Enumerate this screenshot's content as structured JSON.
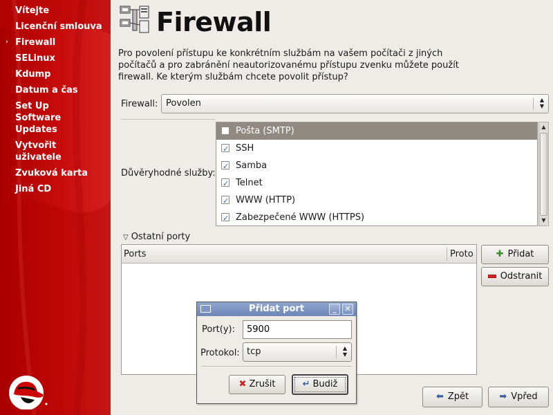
{
  "sidebar": {
    "items": [
      {
        "label": "Vítejte",
        "current": false
      },
      {
        "label": "Licenční smlouva",
        "current": false
      },
      {
        "label": "Firewall",
        "current": true
      },
      {
        "label": "SELinux",
        "current": false
      },
      {
        "label": "Kdump",
        "current": false
      },
      {
        "label": "Datum a čas",
        "current": false
      },
      {
        "label": "Set Up Software Updates",
        "current": false
      },
      {
        "label": "Vytvořit uživatele",
        "current": false
      },
      {
        "label": "Zvuková karta",
        "current": false
      },
      {
        "label": "Jiná CD",
        "current": false
      }
    ],
    "current_marker": "›"
  },
  "header": {
    "title": "Firewall",
    "icon": "firewall-icon"
  },
  "description": "Pro povolení přístupu ke konkrétním službám na vašem počítači z jiných počítačů a pro zabránění neautorizovanému přístupu zvenku můžete použít firewall. Ke kterým službám chcete povolit přístup?",
  "firewall": {
    "label": "Firewall:",
    "value": "Povolen"
  },
  "trusted": {
    "label": "Důvěryhodné služby:",
    "services": [
      {
        "name": "Pošta (SMTP)",
        "checked": false,
        "selected": true
      },
      {
        "name": "SSH",
        "checked": true,
        "selected": false
      },
      {
        "name": "Samba",
        "checked": true,
        "selected": false
      },
      {
        "name": "Telnet",
        "checked": true,
        "selected": false
      },
      {
        "name": "WWW (HTTP)",
        "checked": true,
        "selected": false
      },
      {
        "name": "Zabezpečené WWW (HTTPS)",
        "checked": true,
        "selected": false
      }
    ]
  },
  "other_ports": {
    "label": "Ostatní porty",
    "columns": [
      "Ports",
      "Proto"
    ],
    "add_label": "Přidat",
    "remove_label": "Odstranit"
  },
  "nav": {
    "back_label": "Zpět",
    "next_label": "Vpřed"
  },
  "dialog": {
    "title": "Přidat port",
    "port_label": "Port(y):",
    "port_value": "5900",
    "protocol_label": "Protokol:",
    "protocol_value": "tcp",
    "cancel_label": "Zrušit",
    "ok_label": "Budiž",
    "minimize_glyph": "_",
    "close_glyph": "✕"
  },
  "colors": {
    "sidebar_red": "#c80c0c",
    "selection": "#918a83",
    "titlebar": "#7d95c4"
  }
}
